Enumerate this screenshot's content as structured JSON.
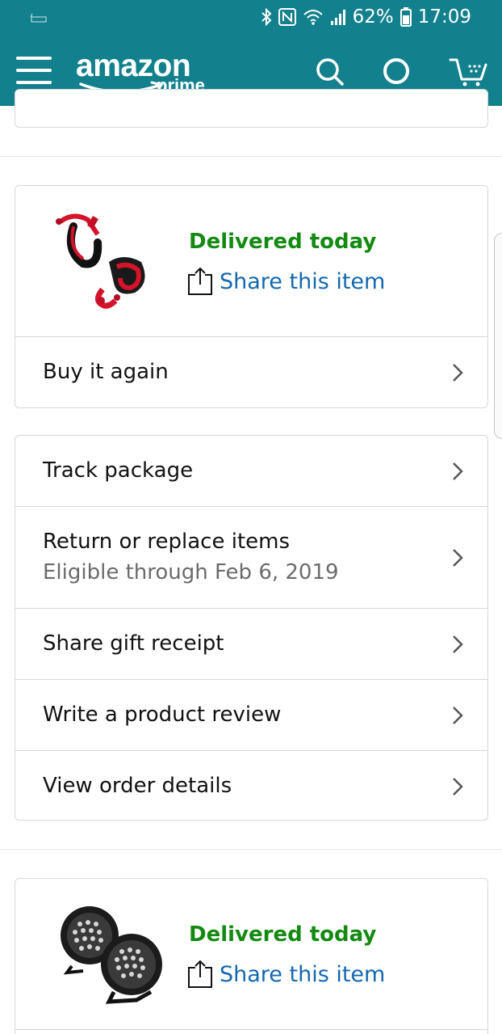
{
  "status_bar": {
    "left_icon": "amazon-notification-icon",
    "left_icon_text": "amazon",
    "battery": "62%",
    "time": "17:09",
    "icons": [
      "bluetooth-icon",
      "nfc-icon",
      "wifi-icon",
      "signal-icon",
      "battery-icon"
    ]
  },
  "header": {
    "logo_main": "amazon",
    "logo_sub": "prime",
    "background": "#13808d",
    "icons": [
      "menu-icon",
      "search-icon",
      "alexa-icon",
      "cart-icon"
    ]
  },
  "orders": [
    {
      "image": "red-shackles",
      "status": "Delivered today",
      "share_label": "Share this item",
      "buy_again_label": "Buy it again"
    },
    {
      "image": "led-work-lights",
      "status": "Delivered today",
      "share_label": "Share this item"
    }
  ],
  "actions": [
    {
      "label": "Track package"
    },
    {
      "label": "Return or replace items",
      "sub": "Eligible through Feb 6, 2019"
    },
    {
      "label": "Share gift receipt"
    },
    {
      "label": "Write a product review"
    },
    {
      "label": "View order details"
    }
  ],
  "colors": {
    "accent": "#13808d",
    "delivered_green": "#158a12",
    "link_blue": "#1468b0"
  }
}
